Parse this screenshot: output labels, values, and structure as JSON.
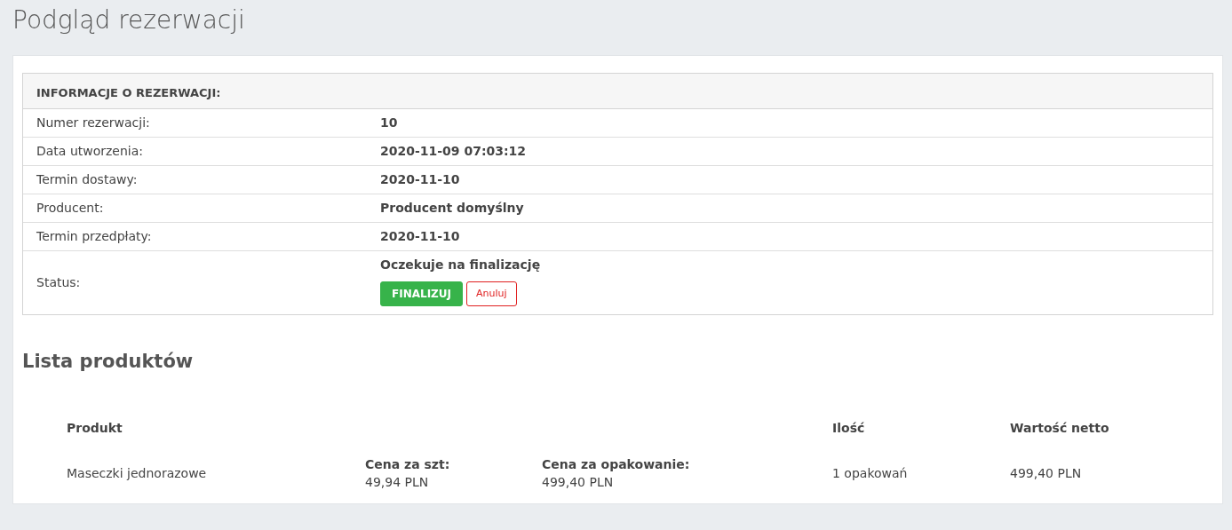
{
  "page_title": "Podgląd rezerwacji",
  "info": {
    "heading": "INFORMACJE O REZERWACJI:",
    "rows": [
      {
        "label": "Numer rezerwacji:",
        "value": "10"
      },
      {
        "label": "Data utworzenia:",
        "value": "2020-11-09 07:03:12"
      },
      {
        "label": "Termin dostawy:",
        "value": "2020-11-10"
      },
      {
        "label": "Producent:",
        "value": "Producent domyślny"
      },
      {
        "label": "Termin przedpłaty:",
        "value": "2020-11-10"
      },
      {
        "label": "Status:",
        "value": "Oczekuje na finalizację",
        "buttons": [
          {
            "label": "FINALIZUJ",
            "kind": "solid"
          },
          {
            "label": "Anuluj",
            "kind": "outline"
          }
        ]
      }
    ]
  },
  "products": {
    "heading": "Lista produktów",
    "columns": [
      {
        "label": "Produkt"
      },
      {
        "label": "Ilość"
      },
      {
        "label": "Wartość netto"
      }
    ],
    "rows": [
      {
        "name": "Maseczki jednorazowe",
        "unit_price_label": "Cena za szt:",
        "unit_price": "49,94 PLN",
        "pack_price_label": "Cena za opakowanie:",
        "pack_price": "499,40 PLN",
        "quantity": "1 opakowań",
        "net_value": "499,40 PLN"
      }
    ]
  }
}
